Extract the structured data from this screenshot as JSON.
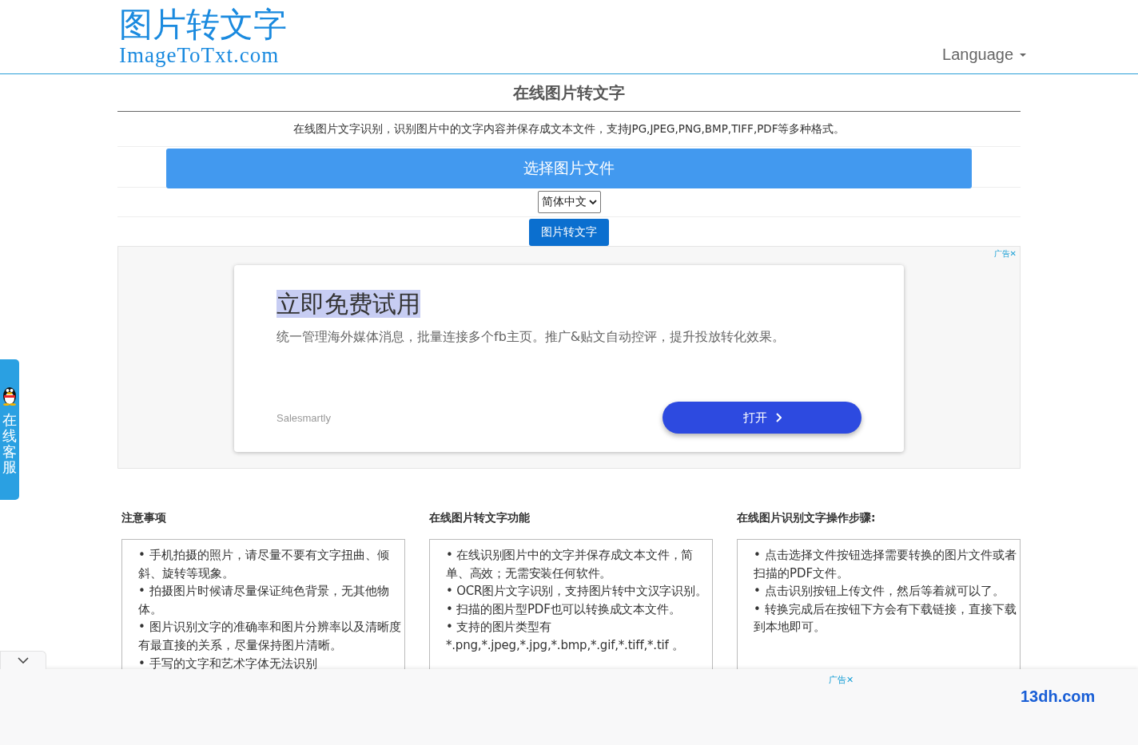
{
  "header": {
    "logo_title": "图片转文字",
    "logo_subtitle": "ImageToTxt.com",
    "language_menu": "Language"
  },
  "main": {
    "title": "在线图片转文字",
    "description": "在线图片文字识别，识别图片中的文字内容并保存成文本文件，支持JPG,JPEG,PNG,BMP,TIFF,PDF等多种格式。",
    "choose_button": "选择图片文件",
    "language_select": "简体中文",
    "convert_button": "图片转文字"
  },
  "ad": {
    "label": "广告",
    "close": "✕",
    "headline": "立即免费试用",
    "text": "统一管理海外媒体消息，批量连接多个fb主页。推广&贴文自动控评，提升投放转化效果。",
    "advertiser": "Salesmartly",
    "button": "打开"
  },
  "side_tab": {
    "label": "在线客服"
  },
  "sections": [
    {
      "heading": "注意事项",
      "items": [
        "• 手机拍摄的照片，请尽量不要有文字扭曲、倾斜、旋转等现象。",
        "• 拍摄图片时候请尽量保证纯色背景，无其他物体。",
        "• 图片识别文字的准确率和图片分辨率以及清晰度有最直接的关系，尽量保持图片清晰。",
        "• 手写的文字和艺术字体无法识别"
      ]
    },
    {
      "heading": "在线图片转文字功能",
      "items": [
        "• 在线识别图片中的文字并保存成文本文件，简单、高效；无需安装任何软件。",
        "• OCR图片文字识别，支持图片转中文汉字识别。",
        "• 扫描的图片型PDF也可以转换成文本文件。",
        "• 支持的图片类型有 *.png,*.jpeg,*.jpg,*.bmp,*.gif,*.tiff,*.tif 。"
      ]
    },
    {
      "heading": "在线图片识别文字操作步骤:",
      "items": [
        "•  点击选择文件按钮选择需要转换的图片文件或者扫描的PDF文件。",
        "•  点击识别按钮上传文件，然后等着就可以了。",
        "•  转换完成后在按钮下方会有下载链接，直接下载到本地即可。"
      ]
    }
  ],
  "bottom_ad": {
    "label": "广告",
    "close": "✕",
    "brand": "13dh.com"
  }
}
